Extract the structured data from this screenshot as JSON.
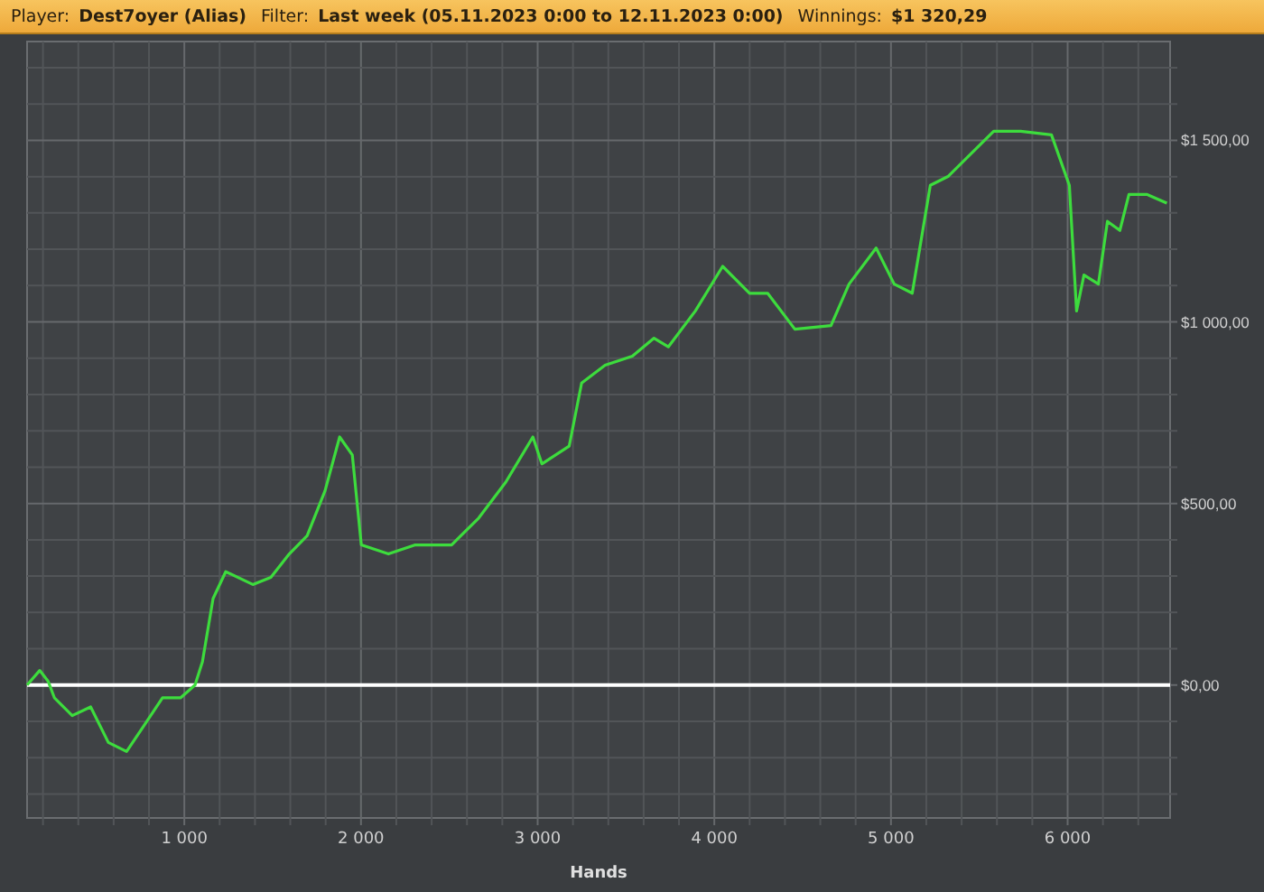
{
  "header": {
    "fields": [
      {
        "label": "Player:",
        "value": "Dest7oyer (Alias)"
      },
      {
        "label": "Filter:",
        "value": "Last week (05.11.2023 0:00 to 12.11.2023 0:00)"
      },
      {
        "label": "Winnings:",
        "value": "$1 320,29"
      }
    ]
  },
  "chart": {
    "chart_data": {
      "type": "line",
      "grid": true,
      "xlabel": "Hands",
      "xlim": [
        110,
        6580
      ],
      "ylim": [
        -366,
        1772
      ],
      "xticks": [
        {
          "value": 1000,
          "label": "1 000"
        },
        {
          "value": 2000,
          "label": "2 000"
        },
        {
          "value": 3000,
          "label": "3 000"
        },
        {
          "value": 4000,
          "label": "4 000"
        },
        {
          "value": 5000,
          "label": "5 000"
        },
        {
          "value": 6000,
          "label": "6 000"
        }
      ],
      "yticks": [
        {
          "value": 0,
          "label": "$0,00"
        },
        {
          "value": 500,
          "label": "$500,00"
        },
        {
          "value": 1000,
          "label": "$1 000,00"
        },
        {
          "value": 1500,
          "label": "$1 500,00"
        }
      ],
      "x": [
        110,
        182,
        230,
        264,
        366,
        470,
        570,
        673,
        775,
        877,
        980,
        1061,
        1102,
        1163,
        1234,
        1388,
        1490,
        1594,
        1695,
        1797,
        1879,
        1951,
        2002,
        2155,
        2308,
        2513,
        2666,
        2820,
        2973,
        3024,
        3178,
        3249,
        3382,
        3536,
        3659,
        3740,
        3893,
        4047,
        4200,
        4302,
        4456,
        4660,
        4763,
        4916,
        5018,
        5120,
        5223,
        5325,
        5478,
        5581,
        5734,
        5908,
        6010,
        6051,
        6092,
        6174,
        6225,
        6296,
        6347,
        6450,
        6562
      ],
      "series": [
        {
          "color": "#3ddc3d",
          "values": [
            0,
            40,
            10,
            -35,
            -84,
            -60,
            -158,
            -183,
            -109,
            -35,
            -35,
            0,
            64,
            238,
            312,
            277,
            297,
            361,
            411,
            535,
            683,
            634,
            386,
            361,
            386,
            386,
            460,
            559,
            683,
            609,
            658,
            832,
            881,
            906,
            955,
            931,
            1030,
            1153,
            1079,
            1079,
            980,
            990,
            1104,
            1203,
            1104,
            1079,
            1376,
            1401,
            1475,
            1525,
            1525,
            1515,
            1376,
            1030,
            1129,
            1104,
            1277,
            1252,
            1351,
            1351,
            1327
          ]
        }
      ]
    }
  }
}
